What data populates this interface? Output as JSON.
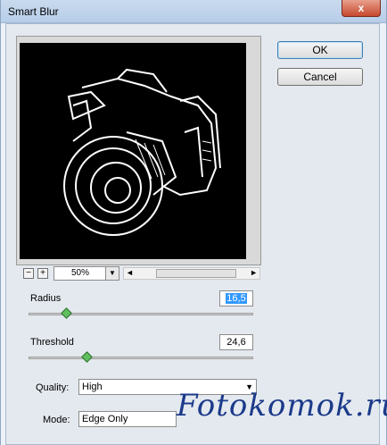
{
  "window": {
    "title": "Smart Blur",
    "close_label": "x"
  },
  "buttons": {
    "ok": "OK",
    "cancel": "Cancel"
  },
  "zoom": {
    "minus": "−",
    "plus": "+",
    "value": "50%",
    "dropdown": "▼",
    "scroll_left": "◄",
    "scroll_right": "►"
  },
  "radius": {
    "label": "Radius",
    "value": "16,5",
    "level": 0.17
  },
  "threshold": {
    "label": "Threshold",
    "value": "24,6",
    "level": 0.26
  },
  "quality": {
    "label": "Quality:",
    "selected": "High"
  },
  "mode": {
    "label": "Mode:",
    "selected": "Edge Only"
  },
  "watermark": "Fotokomok.ru",
  "icons": {
    "select_caret": "triangle-down"
  },
  "colors": {
    "preview_bg": "#000000",
    "slider_thumb": "#5fbf5f",
    "selection": "#3399ff"
  }
}
